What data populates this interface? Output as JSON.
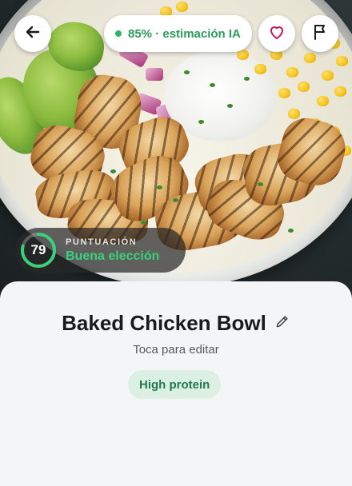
{
  "header": {
    "back_icon": "arrow-left-icon",
    "ai_badge": "85% · estimación IA",
    "ai_status_color": "#2fb56a",
    "favorite_icon": "heart-outline-icon",
    "report_icon": "flag-icon"
  },
  "score": {
    "value": "79",
    "fraction": 0.79,
    "label": "PUNTUACIÓN",
    "verdict": "Buena elección",
    "accent_color": "#39d27a"
  },
  "dish": {
    "title": "Baked Chicken Bowl",
    "edit_icon": "pencil-icon",
    "hint": "Toca para editar",
    "tags": [
      "High protein"
    ]
  }
}
